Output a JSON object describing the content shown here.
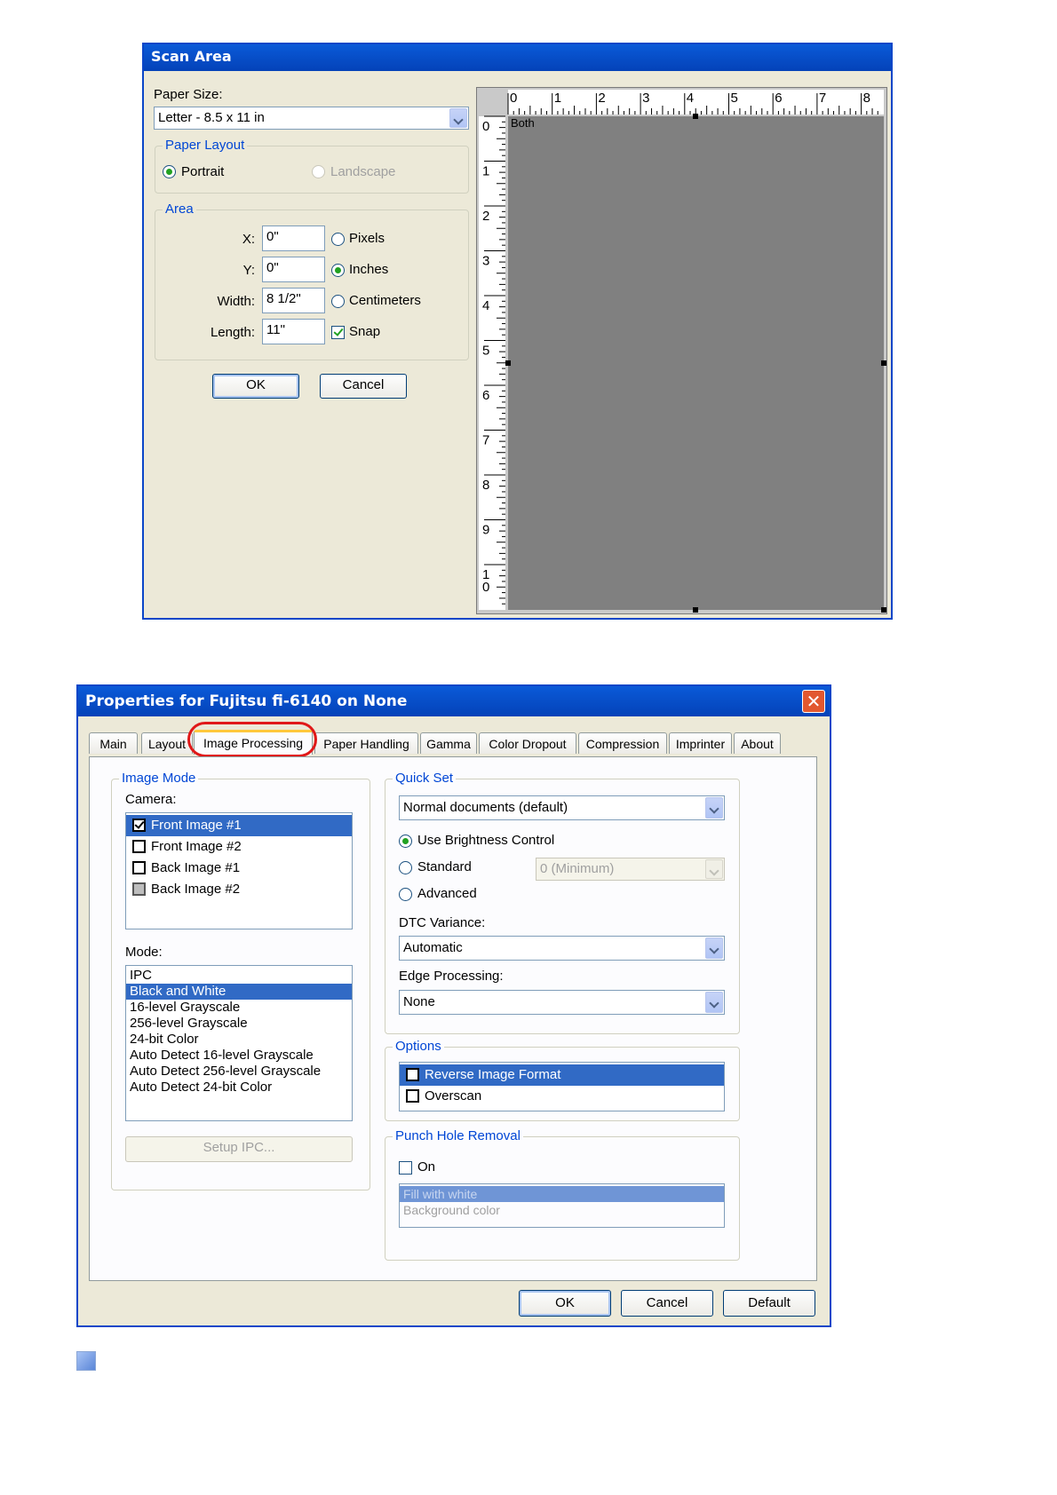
{
  "scan_area": {
    "title": "Scan Area",
    "paper_size_label": "Paper Size:",
    "paper_size_value": "Letter - 8.5 x 11 in",
    "paper_layout_legend": "Paper Layout",
    "portrait_label": "Portrait",
    "landscape_label": "Landscape",
    "area_legend": "Area",
    "x_label": "X:",
    "x_value": "0\"",
    "y_label": "Y:",
    "y_value": "0\"",
    "width_label": "Width:",
    "width_value": "8 1/2\"",
    "length_label": "Length:",
    "length_value": "11\"",
    "pixels_label": "Pixels",
    "inches_label": "Inches",
    "centimeters_label": "Centimeters",
    "snap_label": "Snap",
    "ok_label": "OK",
    "cancel_label": "Cancel",
    "preview_label": "Both",
    "ruler_top": [
      "0",
      "1",
      "2",
      "3",
      "4",
      "5",
      "6",
      "7",
      "8"
    ],
    "ruler_left": [
      "0",
      "1",
      "2",
      "3",
      "4",
      "5",
      "6",
      "7",
      "8",
      "9",
      "1\n0"
    ]
  },
  "properties": {
    "title": "Properties for Fujitsu fi-6140 on None",
    "tabs": [
      "Main",
      "Layout",
      "Image Processing",
      "Paper Handling",
      "Gamma",
      "Color Dropout",
      "Compression",
      "Imprinter",
      "About"
    ],
    "active_tab": "Image Processing",
    "image_mode_legend": "Image Mode",
    "camera_label": "Camera:",
    "camera_items": [
      "Front Image #1",
      "Front Image #2",
      "Back Image #1",
      "Back Image #2"
    ],
    "mode_label": "Mode:",
    "mode_items": [
      "IPC",
      "Black and White",
      "16-level Grayscale",
      "256-level Grayscale",
      "24-bit Color",
      "Auto Detect 16-level Grayscale",
      "Auto Detect 256-level Grayscale",
      "Auto Detect 24-bit Color"
    ],
    "setup_ipc_label": "Setup IPC...",
    "quick_set_legend": "Quick Set",
    "quick_set_value": "Normal documents (default)",
    "use_brightness_label": "Use Brightness Control",
    "standard_label": "Standard",
    "standard_value": "0 (Minimum)",
    "advanced_label": "Advanced",
    "dtc_label": "DTC Variance:",
    "dtc_value": "Automatic",
    "edge_label": "Edge Processing:",
    "edge_value": "None",
    "options_legend": "Options",
    "options_items": [
      "Reverse Image Format",
      "Overscan"
    ],
    "punch_legend": "Punch Hole Removal",
    "on_label": "On",
    "fill_items": [
      "Fill with white",
      "Background color"
    ],
    "ok_label": "OK",
    "cancel_label": "Cancel",
    "default_label": "Default"
  },
  "colors": {
    "title_bar": "#0a5ad8",
    "dialog_bg": "#ece9d8",
    "selection": "#316ac5",
    "highlight_ring": "#e01818",
    "preview_gray": "#808080"
  }
}
